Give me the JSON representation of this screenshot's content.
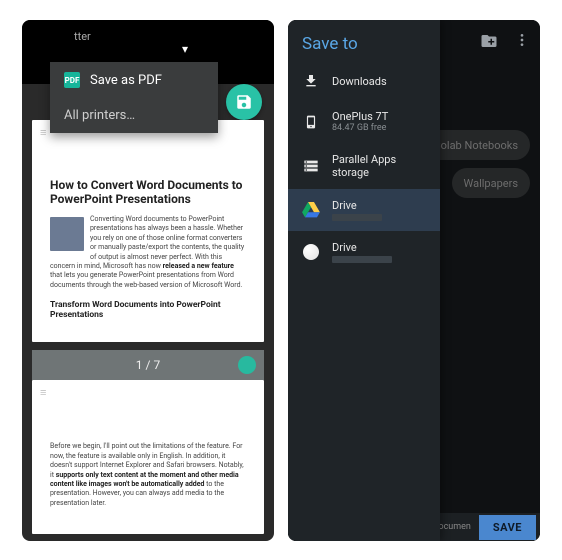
{
  "left": {
    "header": {
      "title": "",
      "subtitle": "tter",
      "chevron": "▾"
    },
    "dropdown": {
      "save_pdf": "Save as PDF",
      "all_printers": "All printers…",
      "pdf_badge": "PDF"
    },
    "fab_icon": "save-icon",
    "page1": {
      "title": "How to Convert Word Documents to PowerPoint Presentations",
      "para1_a": "Converting Word documents to PowerPoint presentations has always been a hassle. Whether you rely on one of those online format converters or manually paste/export the contents, the quality of output is almost never perfect. With this concern in mind, Microsoft has now ",
      "para1_b": "released a new feature",
      "para1_c": " that lets you generate PowerPoint presentations from Word documents through the web-based version of Microsoft Word.",
      "sub": "Transform Word Documents into PowerPoint Presentations"
    },
    "indicator": "1 / 7",
    "page2": {
      "para_a": "Before we begin, I'll point out the limitations of the feature. For now, the feature is available only in English. In addition, it doesn't support Internet Explorer and Safari browsers. Notably, it ",
      "para_b": "supports only text content at the moment and other media content like images won't be automatically added",
      "para_c": " to the presentation. However, you can always add media to the presentation later."
    }
  },
  "right": {
    "title": "Save to",
    "downloads": "Downloads",
    "device_name": "OnePlus 7T",
    "device_sub": "84.47 GB free",
    "parallel": "Parallel Apps storage",
    "drive1": "Drive",
    "drive2": "Drive",
    "dim_a": "Colab Notebooks",
    "dim_b": "Wallpapers",
    "bottom_hint": "ocumen",
    "save": "SAVE"
  }
}
